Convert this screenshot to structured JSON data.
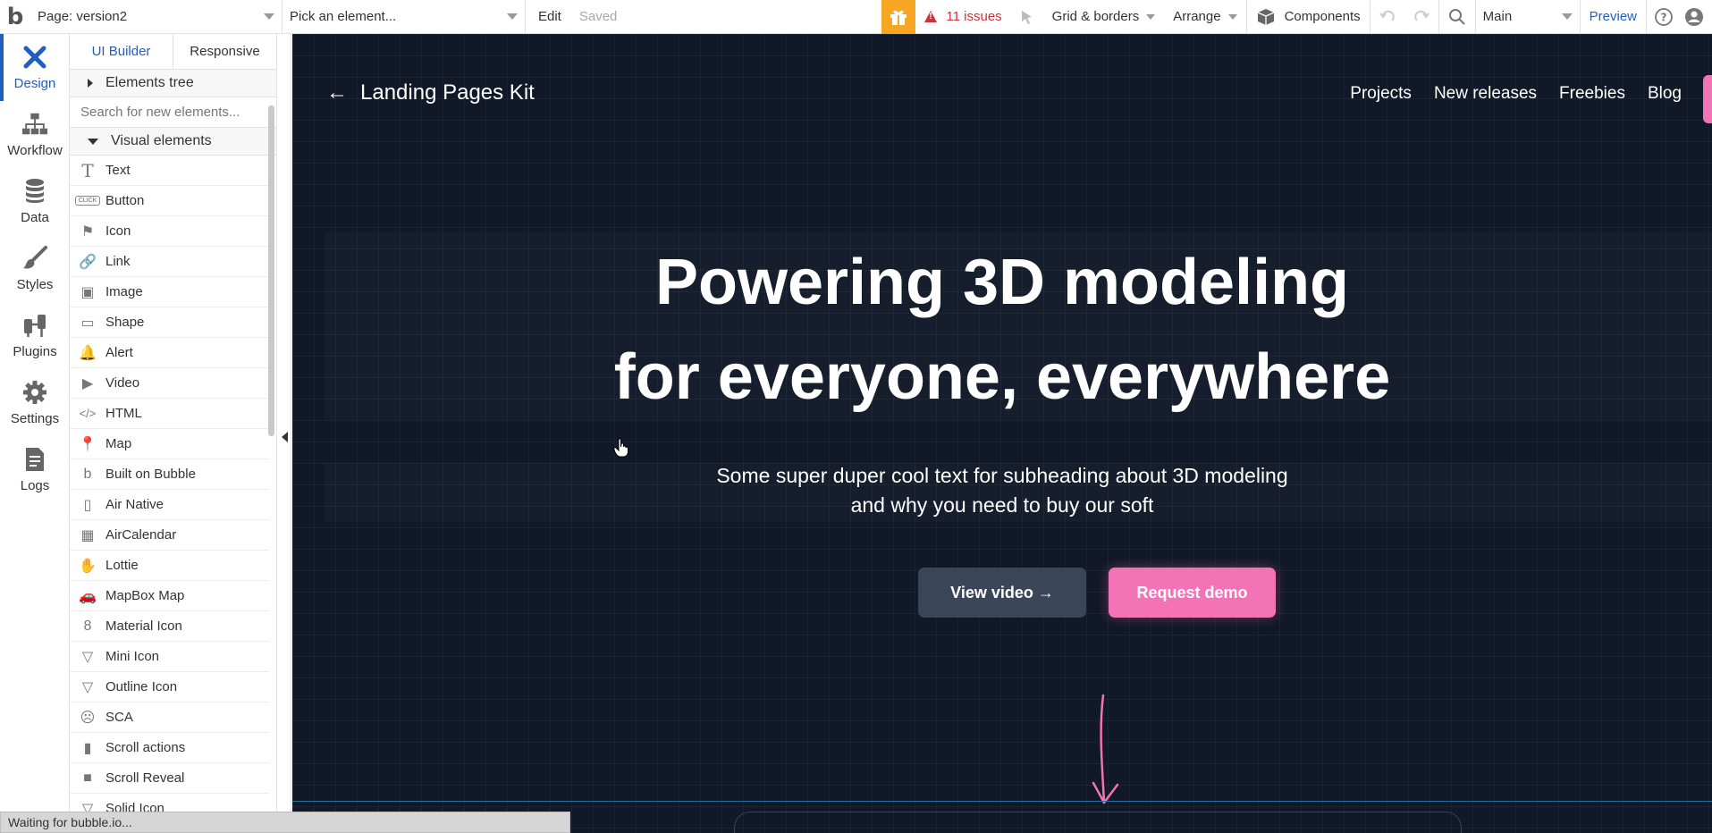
{
  "topbar": {
    "page_select": "Page: version2",
    "element_picker": "Pick an element...",
    "edit": "Edit",
    "saved": "Saved",
    "issues": "11 issues",
    "grid_borders": "Grid & borders",
    "arrange": "Arrange",
    "components": "Components",
    "branch": "Main",
    "preview": "Preview",
    "colors": {
      "gift": "#f5a623",
      "issues": "#d0303a",
      "preview": "#1f5fbf"
    }
  },
  "rail": {
    "items": [
      {
        "label": "Design",
        "icon": "design-icon"
      },
      {
        "label": "Workflow",
        "icon": "workflow-icon"
      },
      {
        "label": "Data",
        "icon": "database-icon"
      },
      {
        "label": "Styles",
        "icon": "brush-icon"
      },
      {
        "label": "Plugins",
        "icon": "plug-icon"
      },
      {
        "label": "Settings",
        "icon": "gear-icon"
      },
      {
        "label": "Logs",
        "icon": "document-icon"
      }
    ]
  },
  "panel": {
    "tabs": [
      "UI Builder",
      "Responsive"
    ],
    "elements_tree": "Elements tree",
    "search_placeholder": "Search for new elements...",
    "visual_elements": "Visual elements",
    "items": [
      {
        "label": "Text",
        "icon": "T"
      },
      {
        "label": "Button",
        "icon": "CLICK"
      },
      {
        "label": "Icon",
        "icon": "⚑"
      },
      {
        "label": "Link",
        "icon": "🔗"
      },
      {
        "label": "Image",
        "icon": "▣"
      },
      {
        "label": "Shape",
        "icon": "▭"
      },
      {
        "label": "Alert",
        "icon": "🔔"
      },
      {
        "label": "Video",
        "icon": "▶"
      },
      {
        "label": "HTML",
        "icon": "</>"
      },
      {
        "label": "Map",
        "icon": "📍"
      },
      {
        "label": "Built on Bubble",
        "icon": "b"
      },
      {
        "label": "Air Native",
        "icon": "▯"
      },
      {
        "label": "AirCalendar",
        "icon": "▦"
      },
      {
        "label": "Lottie",
        "icon": "✋"
      },
      {
        "label": "MapBox Map",
        "icon": "🚗"
      },
      {
        "label": "Material Icon",
        "icon": "8"
      },
      {
        "label": "Mini Icon",
        "icon": "▽"
      },
      {
        "label": "Outline Icon",
        "icon": "▽"
      },
      {
        "label": "SCA",
        "icon": "☹"
      },
      {
        "label": "Scroll actions",
        "icon": "▮"
      },
      {
        "label": "Scroll Reveal",
        "icon": "■"
      },
      {
        "label": "Solid Icon",
        "icon": "▽"
      }
    ]
  },
  "canvas": {
    "back_title": "Landing Pages Kit",
    "nav_links": [
      "Projects",
      "New releases",
      "Freebies",
      "Blog"
    ],
    "hero_line1": "Powering 3D modeling",
    "hero_line2": "for everyone, everywhere",
    "sub_line1": "Some super duper cool text for subheading about 3D modeling",
    "sub_line2": "and why you need to buy our soft",
    "btn_video": "View video →",
    "btn_demo": "Request demo",
    "colors": {
      "background": "#111827",
      "accent": "#f472b6",
      "secondary_button": "#3a4558"
    }
  },
  "status": "Waiting for bubble.io..."
}
